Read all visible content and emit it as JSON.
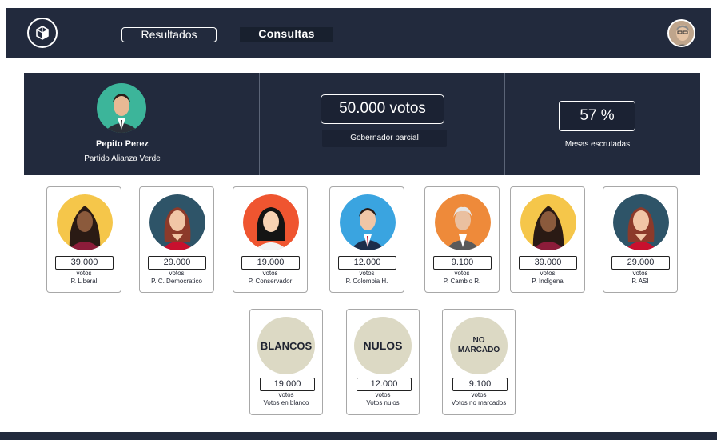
{
  "header": {
    "nav": [
      {
        "label": "Resultados"
      },
      {
        "label": "Consultas"
      }
    ]
  },
  "summary": {
    "leader_name": "Pepito Perez",
    "leader_party": "Partido Alianza Verde",
    "votes": "50.000 votos",
    "votes_label": "Gobernador parcial",
    "percent": "57 %",
    "percent_label": "Mesas escrutadas"
  },
  "candidates": [
    {
      "count": "39.000",
      "unit": "votos",
      "party": "P. Liberal",
      "bg": "#f5c64a"
    },
    {
      "count": "29.000",
      "unit": "votos",
      "party": "P. C. Democratico",
      "bg": "#2e5468"
    },
    {
      "count": "19.000",
      "unit": "votos",
      "party": "P. Conservador",
      "bg": "#ef5530"
    },
    {
      "count": "12.000",
      "unit": "votos",
      "party": "P. Colombia H.",
      "bg": "#3aa4e0"
    },
    {
      "count": "9.100",
      "unit": "votos",
      "party": "P. Cambio R.",
      "bg": "#ee8a3a"
    },
    {
      "count": "39.000",
      "unit": "votos",
      "party": "P. Indigena",
      "bg": "#f5c64a"
    },
    {
      "count": "29.000",
      "unit": "votos",
      "party": "P. ASI",
      "bg": "#2e5468"
    }
  ],
  "special": [
    {
      "title": "BLANCOS",
      "count": "19.000",
      "unit": "votos",
      "label": "Votos en blanco"
    },
    {
      "title": "NULOS",
      "count": "12.000",
      "unit": "votos",
      "label": "Votos nulos"
    },
    {
      "title_line1": "NO",
      "title_line2": "MARCADO",
      "count": "9.100",
      "unit": "votos",
      "label": "Votos no marcados"
    }
  ]
}
